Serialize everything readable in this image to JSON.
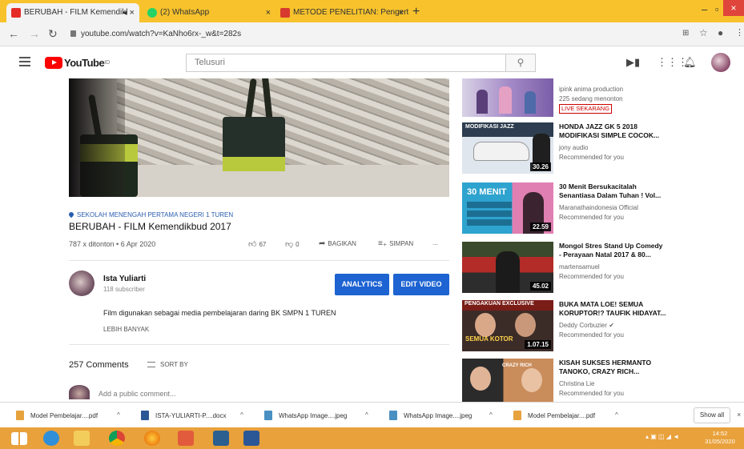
{
  "browser": {
    "tabs": [
      {
        "label": "BERUBAH - FILM Kemendikl",
        "icon": "youtube-icon",
        "color": "#e52d27"
      },
      {
        "label": "(2) WhatsApp",
        "icon": "whatsapp-icon",
        "color": "#25d366"
      },
      {
        "label": "METODE PENELITIAN: Pengertia",
        "icon": "m-icon",
        "color": "#d83a2f"
      }
    ],
    "url": "youtube.com/watch?v=KaNho6rx-_w&t=282s",
    "window_controls": {
      "minimize": "–",
      "maximize": "▫",
      "close": "×"
    }
  },
  "youtube": {
    "logo_text": "YouTube",
    "logo_sup": "ID",
    "search_placeholder": "Telusuri"
  },
  "video": {
    "location": "SEKOLAH MENENGAH PERTAMA NEGERI 1 TUREN",
    "title": "BERUBAH - FILM Kemendikbud 2017",
    "views_date": "787 x ditonton • 6 Apr 2020",
    "likes": "67",
    "dislikes": "0",
    "share_label": "BAGIKAN",
    "save_label": "SIMPAN",
    "more_label": "..."
  },
  "channel": {
    "name": "Ista Yuliarti",
    "subscribers": "118 subscriber",
    "analytics_label": "ANALYTICS",
    "edit_label": "EDIT VIDEO",
    "description": "Film digunakan sebagai media pembelajaran daring BK SMPN 1 TUREN",
    "show_more": "LEBIH BANYAK"
  },
  "comments": {
    "count_label": "257 Comments",
    "sort_label": "SORT BY",
    "placeholder": "Add a public comment..."
  },
  "related": [
    {
      "title": "",
      "channel": "ipink anima production",
      "meta": "225 sedang menonton",
      "badge": "LIVE SEKARANG",
      "duration": "",
      "colors": [
        "#d9d2e6",
        "#7b5ea8"
      ]
    },
    {
      "title_lines": [
        "HONDA JAZZ GK 5 2018",
        "MODIFIKASI SIMPLE COCOK..."
      ],
      "channel": "jony audio",
      "meta": "Recommended for you",
      "duration": "30.26",
      "thumb_text": "MODIFIKASI JAZZ",
      "colors": [
        "#2e3d4f",
        "#dfe6ee"
      ]
    },
    {
      "title_lines": [
        "30 Menit Bersukacitalah",
        "Senantiasa Dalam Tuhan ! Vol..."
      ],
      "channel": "Maranathaindonesia Official",
      "meta": "Recommended for you",
      "duration": "22.59",
      "thumb_text": "30 MENIT",
      "colors": [
        "#2fa3cf",
        "#e07fb2"
      ]
    },
    {
      "title_lines": [
        "Mongol Stres Stand Up Comedy",
        "- Perayaan Natal 2017 & 80..."
      ],
      "channel": "martensamuel",
      "meta": "Recommended for you",
      "duration": "45.02",
      "colors": [
        "#3a4a2c",
        "#b32c27"
      ]
    },
    {
      "title_lines": [
        "BUKA MATA LOE! SEMUA",
        "KORUPTOR!? TAUFIK HIDAYAT..."
      ],
      "channel": "Deddy Corbuzier",
      "meta": "Recommended for you",
      "duration": "1.07.15",
      "thumb_text": "PENGAKUAN EXCLUSIVE",
      "thumb_text2": "SEMUA KOTOR",
      "colors": [
        "#7a1d17",
        "#1a1a1a"
      ]
    },
    {
      "title_lines": [
        "KISAH SUKSES HERMANTO",
        "TANOKO, CRAZY RICH..."
      ],
      "channel": "Christina Lie",
      "meta": "Recommended for you",
      "duration": "",
      "thumb_text": "CRAZY RICH",
      "colors": [
        "#2b2b2b",
        "#c98c5b"
      ]
    }
  ],
  "downloads": {
    "items": [
      {
        "label": "Model Pembelajar....pdf",
        "color": "#e6a23c"
      },
      {
        "label": "ISTA-YULIARTI-P....docx",
        "color": "#2b5797"
      },
      {
        "label": "WhatsApp Image....jpeg",
        "color": "#4a90c2"
      },
      {
        "label": "WhatsApp Image....jpeg",
        "color": "#4a90c2"
      },
      {
        "label": "Model Pembelajar....pdf",
        "color": "#e6a23c"
      }
    ],
    "show_all": "Show all"
  },
  "taskbar": {
    "clock_time": "14:52",
    "clock_date": "31/05/2020"
  }
}
